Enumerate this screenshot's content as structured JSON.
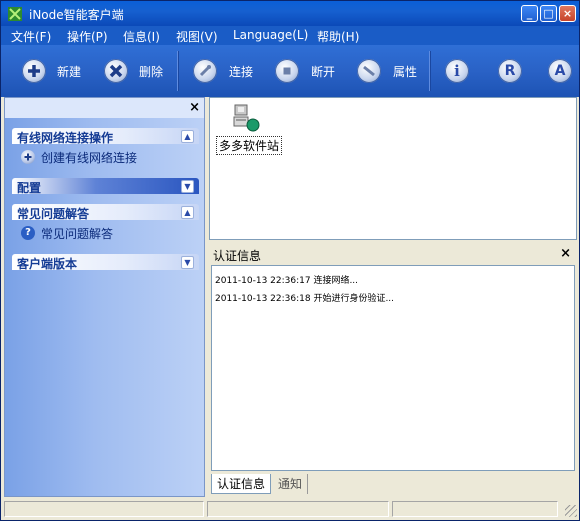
{
  "window": {
    "title": "iNode智能客户端",
    "minimize": "_",
    "maximize": "□",
    "close": "×"
  },
  "menu": [
    "文件(F)",
    "操作(P)",
    "信息(I)",
    "视图(V)",
    "Language(L)",
    "帮助(H)"
  ],
  "toolbar": {
    "new_label": "新建",
    "delete_label": "删除",
    "connect_label": "连接",
    "disconnect_label": "断开",
    "properties_label": "属性",
    "info_icon": "i",
    "r_icon": "R",
    "a_icon": "A"
  },
  "left_panel": {
    "close": "×",
    "groups": [
      {
        "title": "有线网络连接操作",
        "items": [
          "创建有线网络连接"
        ]
      },
      {
        "title": "配置",
        "items": []
      },
      {
        "title": "常见问题解答",
        "items": [
          "常见问题解答"
        ]
      },
      {
        "title": "客户端版本",
        "items": []
      }
    ]
  },
  "connection": {
    "name": "多多软件站"
  },
  "auth": {
    "title": "认证信息",
    "close": "×",
    "logs": [
      "2011-10-13 22:36:17 连接网络...",
      "2011-10-13 22:36:18 开始进行身份验证..."
    ],
    "tabs": [
      "认证信息",
      "通知"
    ]
  }
}
